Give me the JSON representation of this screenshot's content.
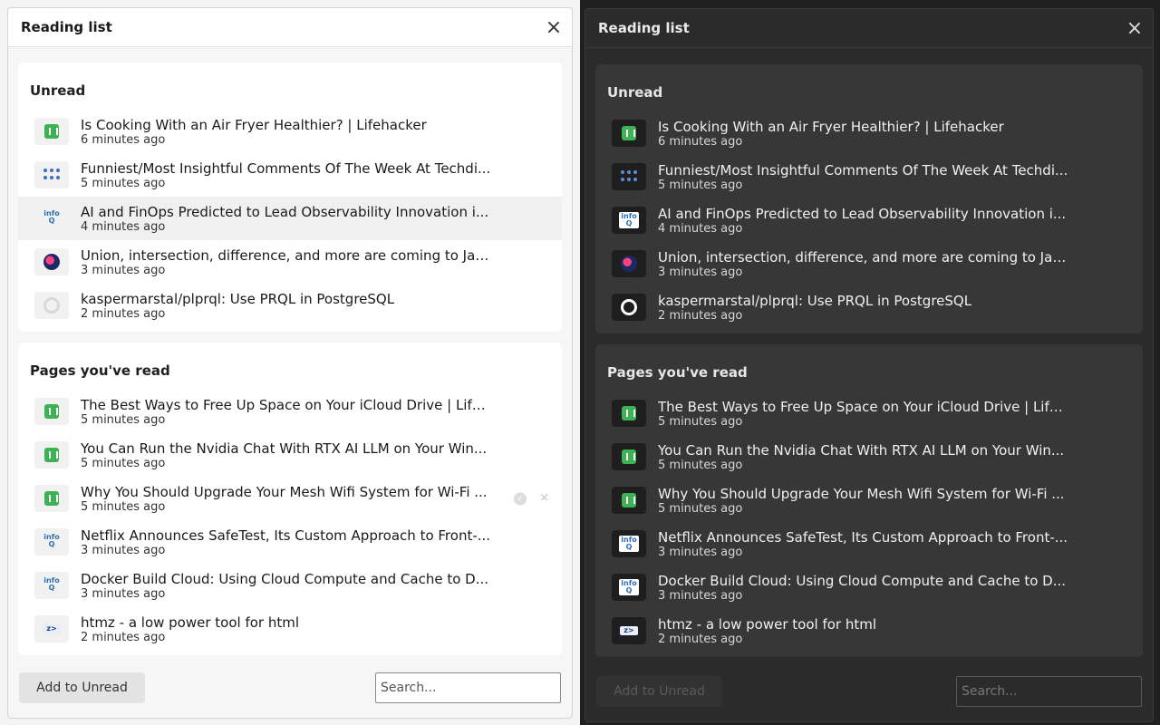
{
  "title": "Reading list",
  "close_icon": "×",
  "sections": {
    "unread": {
      "label": "Unread",
      "items": [
        {
          "title": "Is Cooking With an Air Fryer Healthier? | Lifehacker",
          "time": "6 minutes ago",
          "icon": "lifehacker-icon"
        },
        {
          "title": "Funniest/Most Insightful Comments Of The Week At Techdi...",
          "time": "5 minutes ago",
          "icon": "techdirt-icon"
        },
        {
          "title": "AI and FinOps Predicted to Lead Observability Innovation i...",
          "time": "4 minutes ago",
          "icon": "infoq-icon"
        },
        {
          "title": "Union, intersection, difference, and more are coming to Jav...",
          "time": "3 minutes ago",
          "icon": "webkit-icon"
        },
        {
          "title": "kaspermarstal/plprql: Use PRQL in PostgreSQL",
          "time": "2 minutes ago",
          "icon": "github-icon"
        }
      ]
    },
    "read": {
      "label": "Pages you've read",
      "items": [
        {
          "title": "The Best Ways to Free Up Space on Your iCloud Drive | Life...",
          "time": "5 minutes ago",
          "icon": "lifehacker-icon"
        },
        {
          "title": "You Can Run the Nvidia Chat With RTX AI LLM on Your Win...",
          "time": "5 minutes ago",
          "icon": "lifehacker-icon"
        },
        {
          "title": "Why You Should Upgrade Your Mesh Wifi System for Wi-Fi ...",
          "time": "5 minutes ago",
          "icon": "lifehacker-icon"
        },
        {
          "title": "Netflix Announces SafeTest, Its Custom Approach to Front-...",
          "time": "3 minutes ago",
          "icon": "infoq-icon"
        },
        {
          "title": "Docker Build Cloud: Using Cloud Compute and Cache to D...",
          "time": "3 minutes ago",
          "icon": "infoq-icon"
        },
        {
          "title": "htmz - a low power tool for html",
          "time": "2 minutes ago",
          "icon": "htmz-icon"
        }
      ]
    }
  },
  "footer": {
    "add_label": "Add to Unread",
    "search_placeholder": "Search..."
  },
  "infoq_text": {
    "top": "info",
    "bottom": "Q"
  },
  "htmz_text": "z>",
  "themes": [
    "light",
    "dark"
  ],
  "colors": {
    "lifehacker_green": "#3db154",
    "infoq_blue": "#2d6fb4",
    "dark_bg": "#202020",
    "light_bg": "#f3f3f3"
  }
}
